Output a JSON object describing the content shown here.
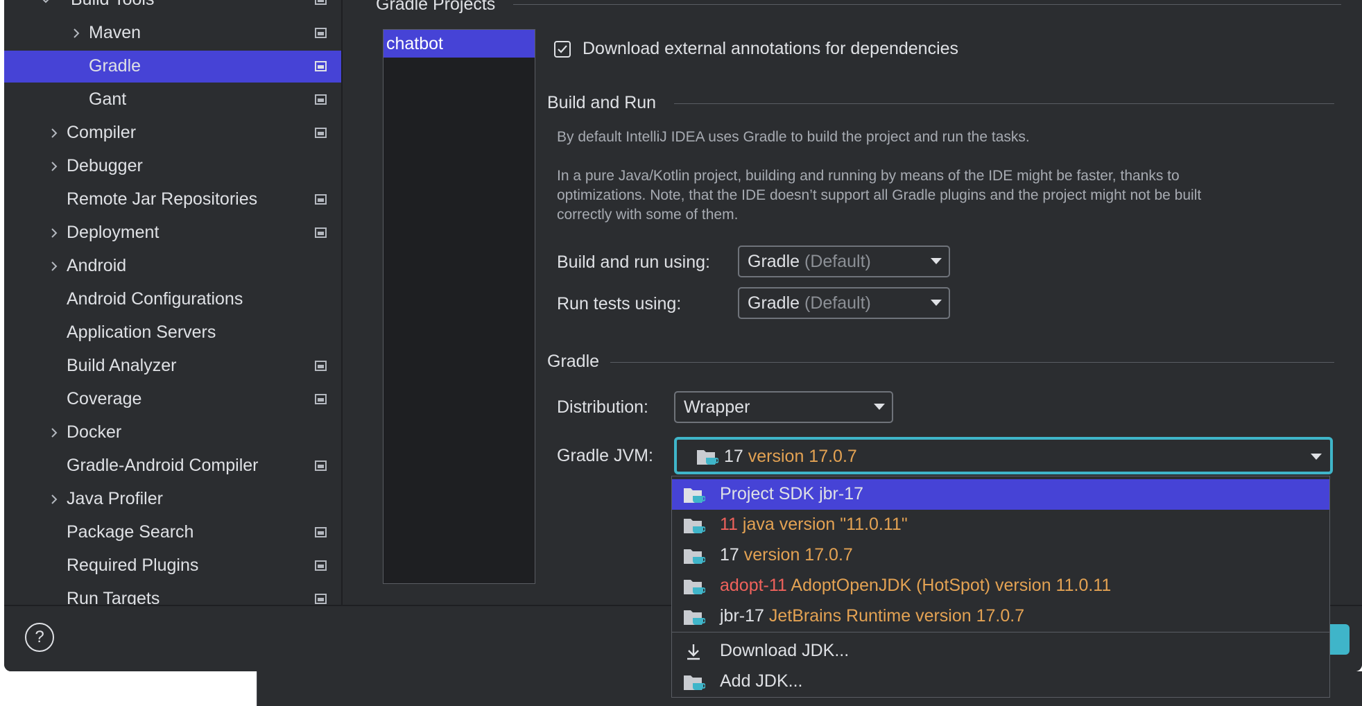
{
  "sidebar": {
    "items": [
      {
        "label": "Build Tools",
        "expandable": true,
        "expanded": true,
        "project_icon": true
      },
      {
        "label": "Maven",
        "expandable": true,
        "project_icon": true
      },
      {
        "label": "Gradle",
        "expandable": false,
        "selected": true,
        "project_icon": true
      },
      {
        "label": "Gant",
        "expandable": false,
        "project_icon": true
      },
      {
        "label": "Compiler",
        "expandable": true,
        "project_icon": true
      },
      {
        "label": "Debugger",
        "expandable": true,
        "project_icon": false
      },
      {
        "label": "Remote Jar Repositories",
        "expandable": false,
        "project_icon": true
      },
      {
        "label": "Deployment",
        "expandable": true,
        "project_icon": true
      },
      {
        "label": "Android",
        "expandable": true,
        "project_icon": false
      },
      {
        "label": "Android Configurations",
        "expandable": false,
        "project_icon": false
      },
      {
        "label": "Application Servers",
        "expandable": false,
        "project_icon": false
      },
      {
        "label": "Build Analyzer",
        "expandable": false,
        "project_icon": true
      },
      {
        "label": "Coverage",
        "expandable": false,
        "project_icon": true
      },
      {
        "label": "Docker",
        "expandable": true,
        "project_icon": false
      },
      {
        "label": "Gradle-Android Compiler",
        "expandable": false,
        "project_icon": true
      },
      {
        "label": "Java Profiler",
        "expandable": true,
        "project_icon": false
      },
      {
        "label": "Package Search",
        "expandable": false,
        "project_icon": true
      },
      {
        "label": "Required Plugins",
        "expandable": false,
        "project_icon": true
      },
      {
        "label": "Run Targets",
        "expandable": false,
        "project_icon": true
      }
    ]
  },
  "main": {
    "gradle_projects_title": "Gradle Projects",
    "projects": [
      "chatbot"
    ],
    "download_annotations": {
      "label": "Download external annotations for dependencies",
      "checked": true
    },
    "build_and_run": {
      "title": "Build and Run",
      "desc1": "By default IntelliJ IDEA uses Gradle to build the project and run the tasks.",
      "desc2_line1": "In a pure Java/Kotlin project, building and running by means of the IDE might be faster, thanks to",
      "desc2_line2": "optimizations. Note, that the IDE doesn’t support all Gradle plugins and the project might not be built",
      "desc2_line3": "correctly with some of them.",
      "build_run_label": "Build and run using:",
      "build_run_value": "Gradle",
      "build_run_suffix": "(Default)",
      "tests_label": "Run tests using:",
      "tests_value": "Gradle",
      "tests_suffix": "(Default)"
    },
    "gradle": {
      "title": "Gradle",
      "distribution_label": "Distribution:",
      "distribution_value": "Wrapper",
      "jvm_label": "Gradle JVM:",
      "jvm_value_name": "17",
      "jvm_value_version": "version 17.0.7"
    }
  },
  "jvm_popup": {
    "options": [
      {
        "name": "Project SDK jbr-17",
        "detail": "",
        "selected": true
      },
      {
        "name": "11",
        "detail": "java version \"11.0.11\"",
        "name_red": true
      },
      {
        "name": "17",
        "detail": "version 17.0.7"
      },
      {
        "name": "adopt-11",
        "detail": "AdoptOpenJDK (HotSpot) version 11.0.11",
        "name_red": true
      },
      {
        "name": "jbr-17",
        "detail": "JetBrains Runtime version 17.0.7"
      }
    ],
    "actions": {
      "download": "Download JDK...",
      "add": "Add JDK..."
    }
  },
  "bottom": {
    "help_glyph": "?"
  },
  "colors": {
    "selection": "#4643d6",
    "focus": "#3fb5c9",
    "version_text": "#e3a253",
    "invalid_text": "#f0625c",
    "background": "#2b2d30"
  }
}
